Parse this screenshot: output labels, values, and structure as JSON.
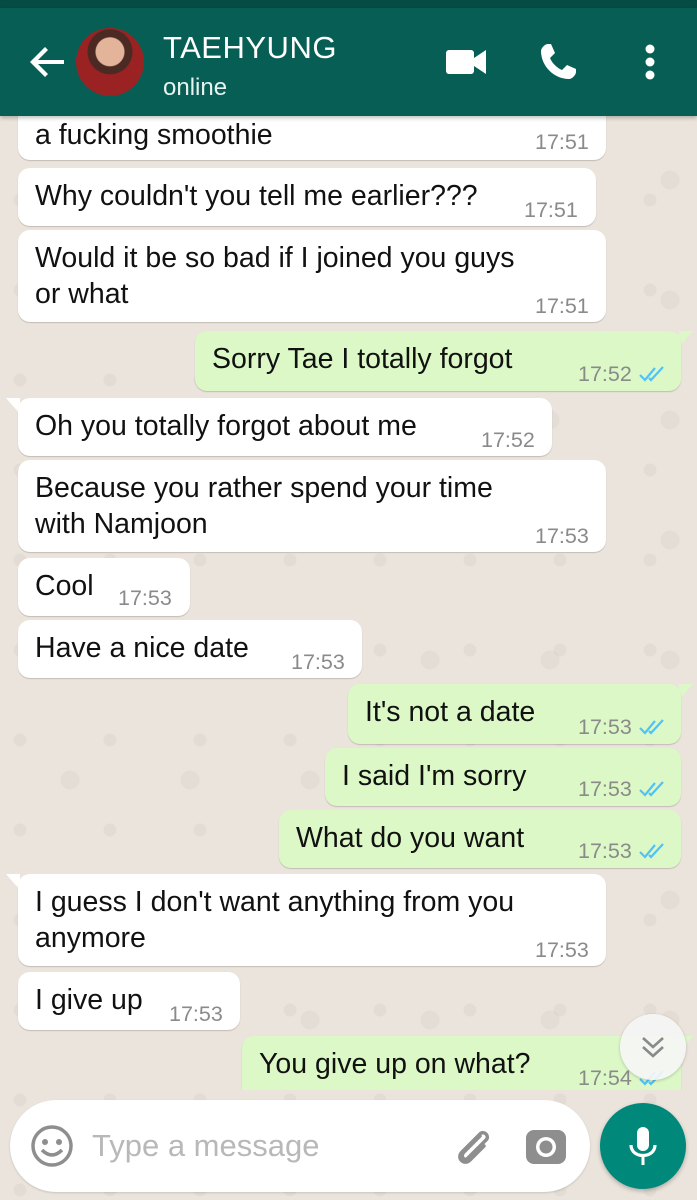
{
  "header": {
    "contact_name": "TAEHYUNG",
    "status": "online",
    "icons": [
      "back-arrow-icon",
      "video-call-icon",
      "phone-icon",
      "more-options-icon"
    ]
  },
  "messages": [
    {
      "dir": "in",
      "lines": [
        "a fucking smoothie"
      ],
      "time": "17:51"
    },
    {
      "dir": "in",
      "lines": [
        "Why couldn't you tell me earlier???"
      ],
      "time": "17:51"
    },
    {
      "dir": "in",
      "lines": [
        "Would it be so bad if I joined you guys",
        "or what"
      ],
      "time": "17:51"
    },
    {
      "dir": "out",
      "lines": [
        "Sorry Tae I totally forgot"
      ],
      "time": "17:52",
      "read": true
    },
    {
      "dir": "in",
      "lines": [
        "Oh you totally forgot about me"
      ],
      "time": "17:52"
    },
    {
      "dir": "in",
      "lines": [
        "Because you rather spend your time",
        "with Namjoon"
      ],
      "time": "17:53"
    },
    {
      "dir": "in",
      "lines": [
        "Cool"
      ],
      "time": "17:53"
    },
    {
      "dir": "in",
      "lines": [
        "Have a nice date"
      ],
      "time": "17:53"
    },
    {
      "dir": "out",
      "lines": [
        "It's not a date"
      ],
      "time": "17:53",
      "read": true
    },
    {
      "dir": "out",
      "lines": [
        "I said I'm sorry"
      ],
      "time": "17:53",
      "read": true
    },
    {
      "dir": "out",
      "lines": [
        "What do you want"
      ],
      "time": "17:53",
      "read": true
    },
    {
      "dir": "in",
      "lines": [
        "I guess I don't want anything from you",
        "anymore"
      ],
      "time": "17:53"
    },
    {
      "dir": "in",
      "lines": [
        "I give up"
      ],
      "time": "17:53"
    },
    {
      "dir": "out",
      "lines": [
        "You give up on what?"
      ],
      "time": "17:54",
      "read": true
    }
  ],
  "composer": {
    "placeholder": "Type a message"
  },
  "colors": {
    "header": "#075e54",
    "incoming_bubble": "#ffffff",
    "outgoing_bubble": "#dcf8c6",
    "read_ticks": "#4fc3f7",
    "mic_button": "#00897b"
  }
}
